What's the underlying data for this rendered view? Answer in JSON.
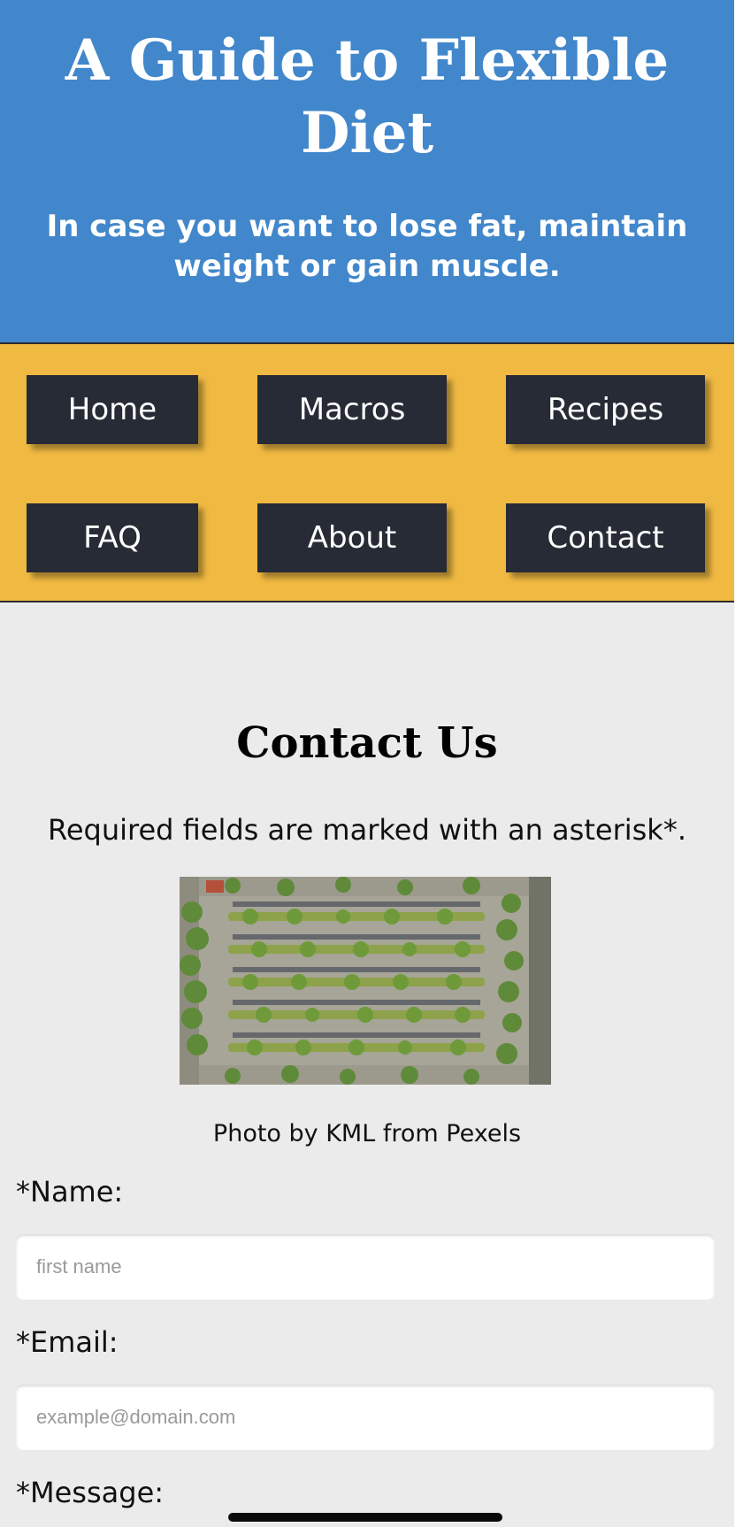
{
  "header": {
    "title": "A Guide to Flexible Diet",
    "subtitle": "In case you want to lose fat, maintain weight or gain muscle."
  },
  "nav": {
    "items": [
      {
        "label": "Home"
      },
      {
        "label": "Macros"
      },
      {
        "label": "Recipes"
      },
      {
        "label": "FAQ"
      },
      {
        "label": "About"
      },
      {
        "label": "Contact"
      }
    ]
  },
  "contact": {
    "title": "Contact Us",
    "required_note": "Required fields are marked with an asterisk*.",
    "photo_credit": "Photo by KML from Pexels",
    "fields": {
      "name_label": "*Name:",
      "name_placeholder": "first name",
      "email_label": "*Email:",
      "email_placeholder": "example@domain.com",
      "message_label": "*Message:"
    }
  },
  "colors": {
    "header_bg": "#4287cb",
    "nav_bg": "#f0b942",
    "nav_button_bg": "#262b35",
    "page_bg": "#ebebeb"
  }
}
